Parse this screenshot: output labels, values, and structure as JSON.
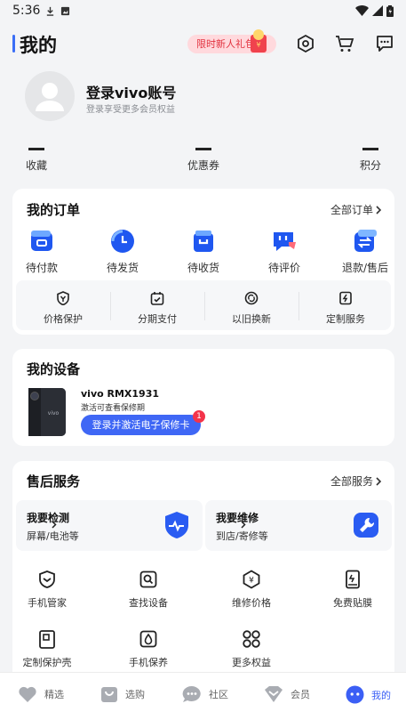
{
  "status_bar": {
    "time": "5:36"
  },
  "header": {
    "title": "我的",
    "promo": "限时新人礼包"
  },
  "profile": {
    "title": "登录vivo账号",
    "subtitle": "登录享受更多会员权益"
  },
  "stats": [
    {
      "value": "—",
      "label": "收藏"
    },
    {
      "value": "—",
      "label": "优惠券"
    },
    {
      "value": "—",
      "label": "积分"
    }
  ],
  "orders": {
    "title": "我的订单",
    "more": "全部订单",
    "items": [
      {
        "label": "待付款",
        "icon": "wallet-icon"
      },
      {
        "label": "待发货",
        "icon": "clock-icon"
      },
      {
        "label": "待收货",
        "icon": "shopping-bag-icon"
      },
      {
        "label": "待评价",
        "icon": "review-chat-icon"
      },
      {
        "label": "退款/售后",
        "icon": "refund-exchange-icon"
      }
    ],
    "services": [
      {
        "label": "价格保护",
        "icon": "price-shield-icon"
      },
      {
        "label": "分期支付",
        "icon": "calendar-check-icon"
      },
      {
        "label": "以旧换新",
        "icon": "trade-in-icon"
      },
      {
        "label": "定制服务",
        "icon": "lightning-doc-icon"
      }
    ]
  },
  "devices": {
    "title": "我的设备",
    "name": "vivo RMX1931",
    "subtitle": "激活可查看保修期",
    "button": "登录并激活电子保修卡",
    "badge": "1",
    "phone_mark": "vivo"
  },
  "after_sales": {
    "title": "售后服务",
    "more": "全部服务",
    "boxes": [
      {
        "title": "我要检测",
        "subtitle": "屏幕/电池等",
        "icon": "diagnostic-shield-icon"
      },
      {
        "title": "我要维修",
        "subtitle": "到店/寄修等",
        "icon": "repair-wrench-icon"
      }
    ],
    "grid": [
      {
        "label": "手机管家",
        "icon": "shield-check-icon"
      },
      {
        "label": "查找设备",
        "icon": "find-device-icon"
      },
      {
        "label": "维修价格",
        "icon": "price-tag-icon"
      },
      {
        "label": "免费贴膜",
        "icon": "screen-film-icon"
      },
      {
        "label": "定制保护壳",
        "icon": "phone-case-icon"
      },
      {
        "label": "手机保养",
        "icon": "care-drop-icon"
      },
      {
        "label": "更多权益",
        "icon": "more-grid-icon"
      }
    ]
  },
  "tabbar": [
    {
      "label": "精选",
      "icon": "heart-tab-icon"
    },
    {
      "label": "选购",
      "icon": "shop-bag-tab-icon"
    },
    {
      "label": "社区",
      "icon": "community-chat-tab-icon"
    },
    {
      "label": "会员",
      "icon": "member-diamond-tab-icon"
    },
    {
      "label": "我的",
      "icon": "me-face-tab-icon"
    }
  ],
  "colors": {
    "accent": "#3b6ef6",
    "badge": "#f3334a",
    "promo_text": "#e2323f"
  }
}
